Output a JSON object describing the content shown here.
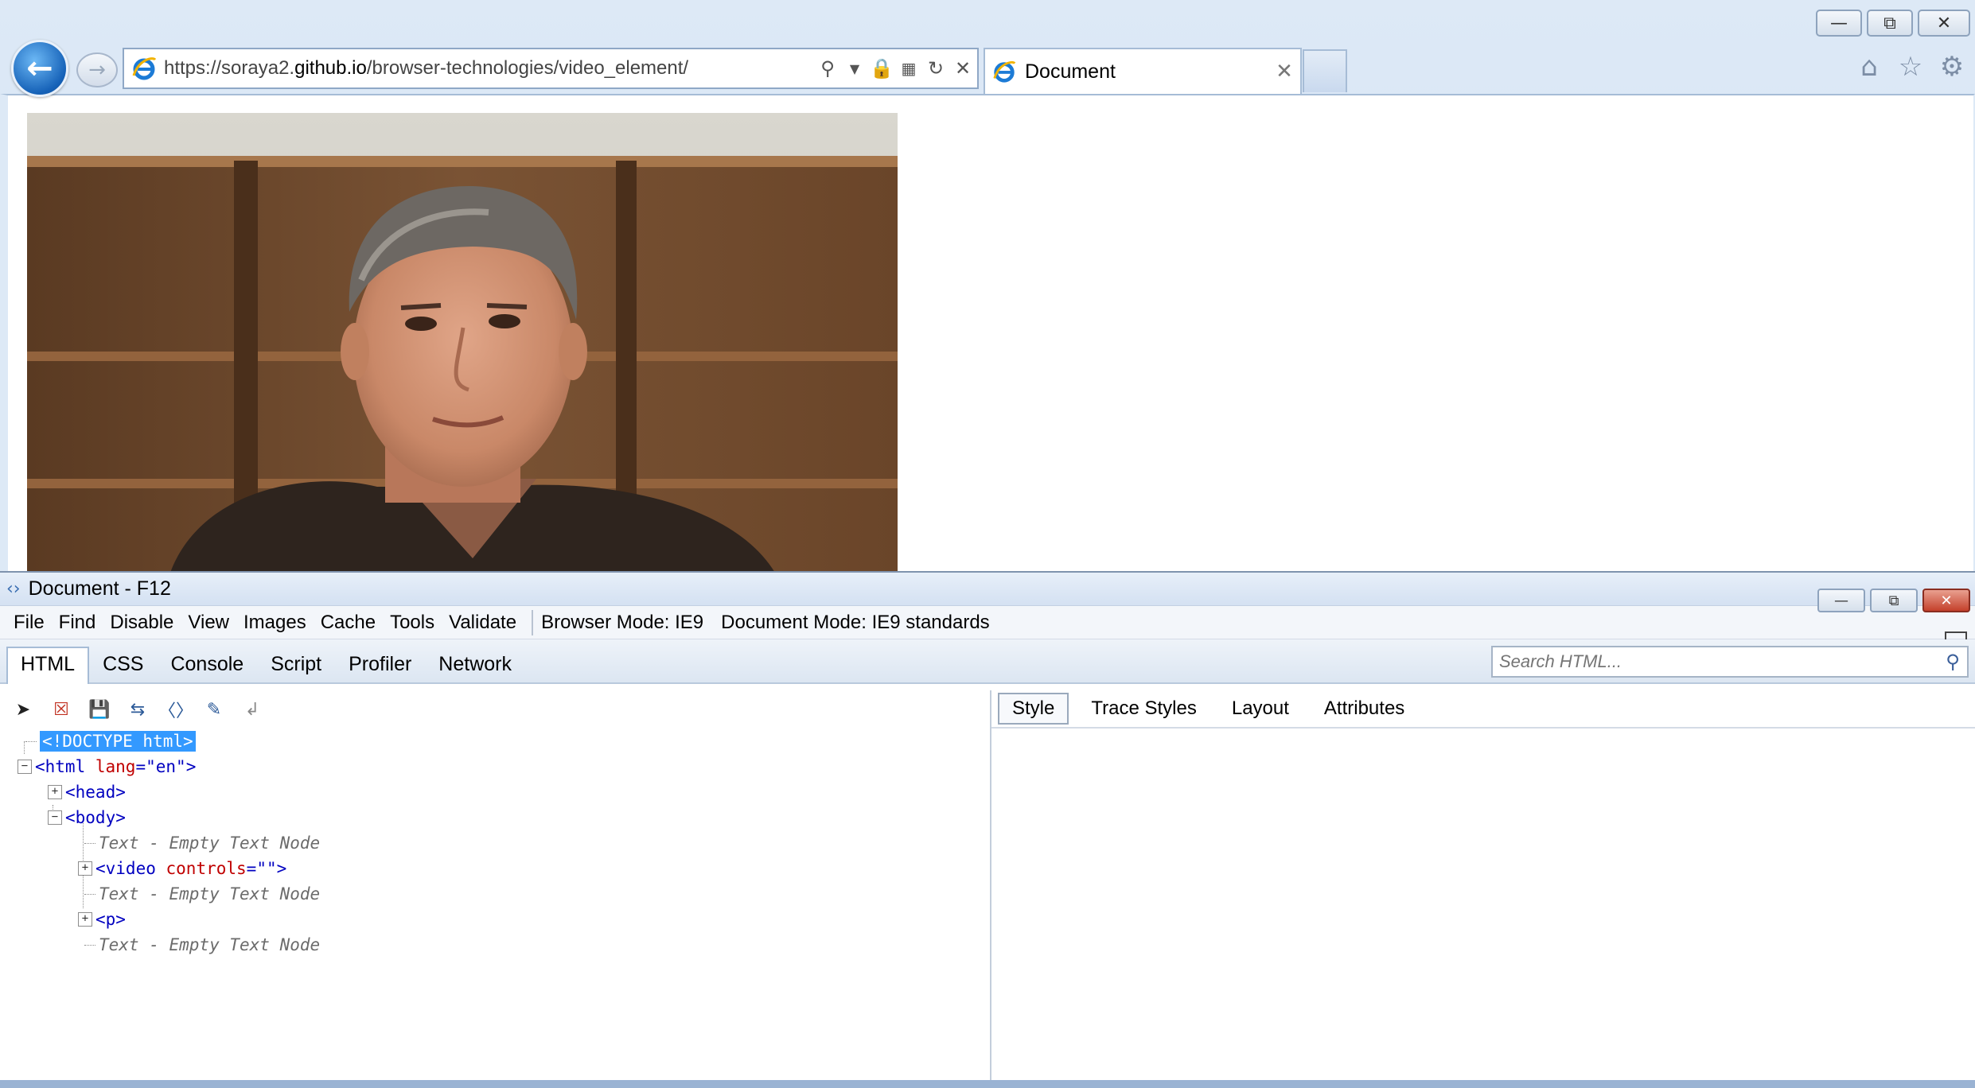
{
  "browser": {
    "address": {
      "url_prefix": "https://soraya2.",
      "url_host": "github.io",
      "url_path": "/browser-technologies/video_element/"
    },
    "tab": {
      "label": "Document"
    }
  },
  "devtools": {
    "title": "Document - F12",
    "menu": [
      "File",
      "Find",
      "Disable",
      "View",
      "Images",
      "Cache",
      "Tools",
      "Validate"
    ],
    "browser_mode": "Browser Mode: IE9",
    "document_mode": "Document Mode: IE9 standards",
    "tabs": [
      "HTML",
      "CSS",
      "Console",
      "Script",
      "Profiler",
      "Network"
    ],
    "search_placeholder": "Search HTML...",
    "style_tabs": [
      "Style",
      "Trace Styles",
      "Layout",
      "Attributes"
    ],
    "tree": {
      "doctype": "<!DOCTYPE html>",
      "html_open": "<html",
      "html_attr": "lang",
      "html_val": "\"en\"",
      "html_close": ">",
      "head": "<head>",
      "body": "<body>",
      "empty_text": "Text - Empty Text Node",
      "video_open": "<video",
      "video_attr": "controls",
      "video_val": "\"\"",
      "video_close": ">",
      "p": "<p>"
    }
  },
  "colors": {
    "selection": "#3399ff",
    "tag": "#0000c0",
    "attr": "#c00000"
  }
}
